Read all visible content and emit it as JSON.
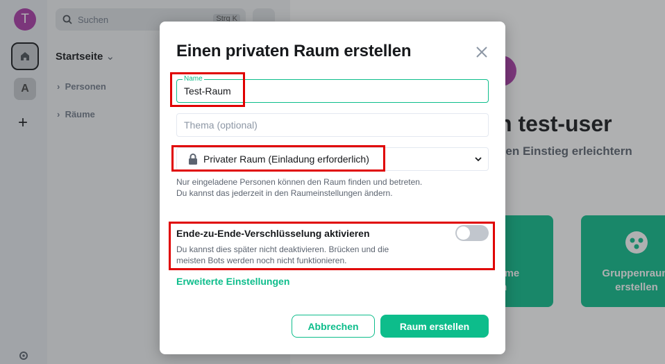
{
  "app": {
    "user_initial": "T",
    "space_initial": "A",
    "search_placeholder": "Suchen",
    "search_shortcut": "Strg K",
    "home_title": "Startseite",
    "sections": [
      "Personen",
      "Räume"
    ],
    "welcome_title": "n test-user",
    "welcome_subtitle": "den Einstieg erleichtern",
    "cards": [
      "e Räume\nden",
      "Gruppenraum\nerstellen"
    ]
  },
  "dialog": {
    "title": "Einen privaten Raum erstellen",
    "name_label": "Name",
    "name_value": "Test-Raum",
    "topic_placeholder": "Thema (optional)",
    "join_rule": "Privater Raum (Einladung erforderlich)",
    "join_help": "Nur eingeladene Personen können den Raum finden und betreten. Du kannst das jederzeit in den Raumeinstellungen ändern.",
    "e2e_label": "Ende-zu-Ende-Verschlüsselung aktivieren",
    "e2e_enabled": false,
    "e2e_help": "Du kannst dies später nicht deaktivieren. Brücken und die meisten Bots werden noch nicht funktionieren.",
    "advanced_link": "Erweiterte Einstellungen",
    "cancel_label": "Abbrechen",
    "create_label": "Raum erstellen"
  },
  "colors": {
    "accent": "#0dbd8b",
    "annotation": "#e00000",
    "avatar": "#ac3ba8"
  }
}
